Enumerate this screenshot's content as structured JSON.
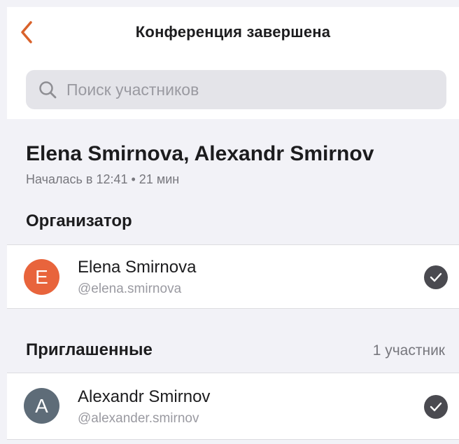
{
  "header": {
    "title": "Конференция завершена",
    "back_icon": "chevron-left-icon"
  },
  "search": {
    "placeholder": "Поиск участников",
    "icon": "search-icon"
  },
  "conference": {
    "title": "Elena Smirnova, Alexandr Smirnov",
    "subtitle": "Началась в 12:41 • 21 мин"
  },
  "organizer": {
    "section_title": "Организатор",
    "participant": {
      "initial": "E",
      "name": "Elena Smirnova",
      "handle": "@elena.smirnova",
      "avatar_color": "#e8643c",
      "status_icon": "check-circle-icon"
    }
  },
  "invited": {
    "section_title": "Приглашенные",
    "count_label": "1 участник",
    "participants": [
      {
        "initial": "A",
        "name": "Alexandr Smirnov",
        "handle": "@alexander.smirnov",
        "avatar_color": "#5e6c78",
        "status_icon": "check-circle-icon"
      }
    ]
  },
  "colors": {
    "accent": "#d9622b",
    "background": "#f2f2f7",
    "check": "#4a4a50"
  }
}
